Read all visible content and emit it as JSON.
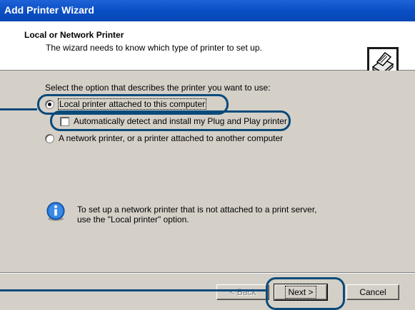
{
  "window": {
    "title": "Add Printer Wizard"
  },
  "header": {
    "title": "Local or Network Printer",
    "subtitle": "The wizard needs to know which type of printer to set up."
  },
  "body": {
    "prompt": "Select the option that describes the printer you want to use:",
    "options": [
      {
        "label": "Local printer attached to this computer",
        "selected": true
      },
      {
        "label": "Automatically detect and install my Plug and Play printer",
        "checked": false
      },
      {
        "label": "A network printer, or a printer attached to another computer",
        "selected": false
      }
    ],
    "info": "To set up a network printer that is not attached to a print server, use the \"Local printer\" option."
  },
  "buttons": {
    "back": "< Back",
    "next": "Next >",
    "cancel": "Cancel"
  },
  "icons": {
    "header": "printer-icon",
    "info": "info-icon"
  },
  "colors": {
    "titlebar": "#0a4fc4",
    "callout": "#0a4a7a",
    "dialog": "#d4d0c8"
  }
}
